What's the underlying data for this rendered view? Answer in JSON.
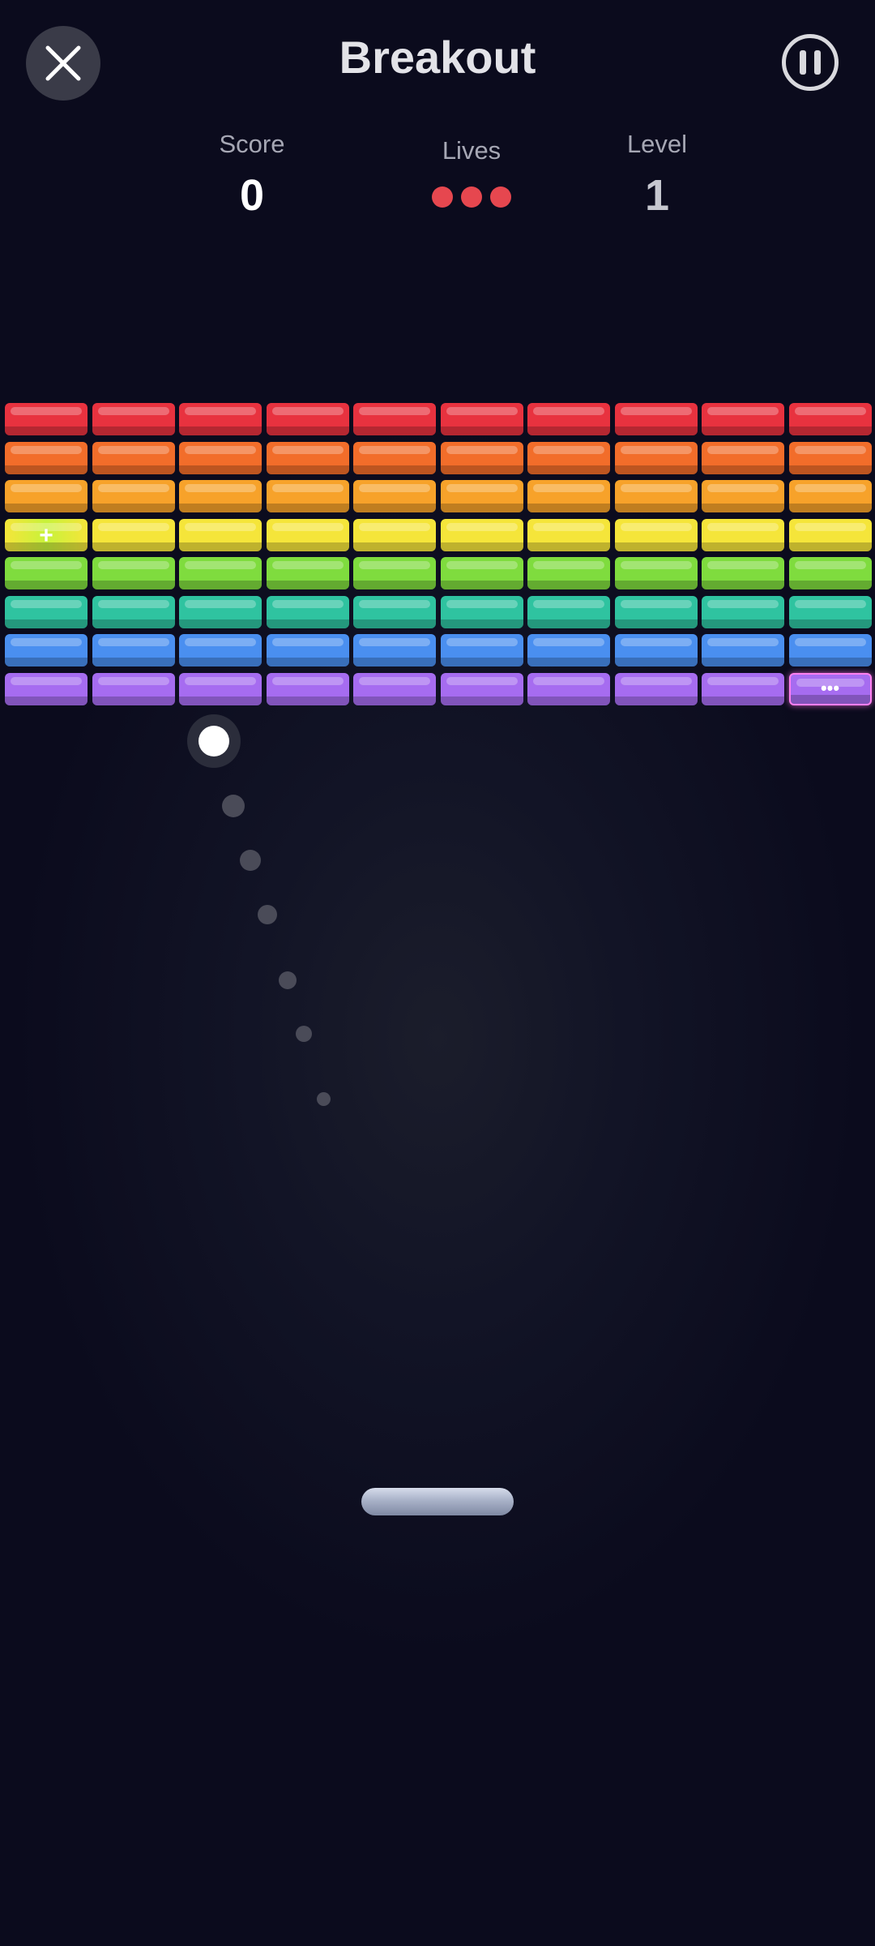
{
  "header": {
    "title": "Breakout",
    "close_icon": "close-icon",
    "pause_icon": "pause-icon"
  },
  "stats": {
    "score_label": "Score",
    "score_value": "0",
    "lives_label": "Lives",
    "lives_count": 3,
    "level_label": "Level",
    "level_value": "1"
  },
  "bricks": {
    "columns": 10,
    "rows": [
      {
        "name": "red",
        "color": "#e8323f"
      },
      {
        "name": "orange",
        "color": "#f26d2a"
      },
      {
        "name": "amber",
        "color": "#f7a22a"
      },
      {
        "name": "yellow",
        "color": "#f5e53a"
      },
      {
        "name": "green",
        "color": "#7fdc3e"
      },
      {
        "name": "teal",
        "color": "#2fc3a0"
      },
      {
        "name": "blue",
        "color": "#4a8ff0"
      },
      {
        "name": "purple",
        "color": "#a66cf0"
      }
    ],
    "powerups": [
      {
        "row": 3,
        "col": 0,
        "mark": "+",
        "type": "extra"
      },
      {
        "row": 7,
        "col": 9,
        "mark": "•••",
        "type": "multiball"
      }
    ]
  },
  "colors": {
    "life": "#e6474f",
    "paddle": "#aab3c8",
    "ball": "#ffffff"
  }
}
